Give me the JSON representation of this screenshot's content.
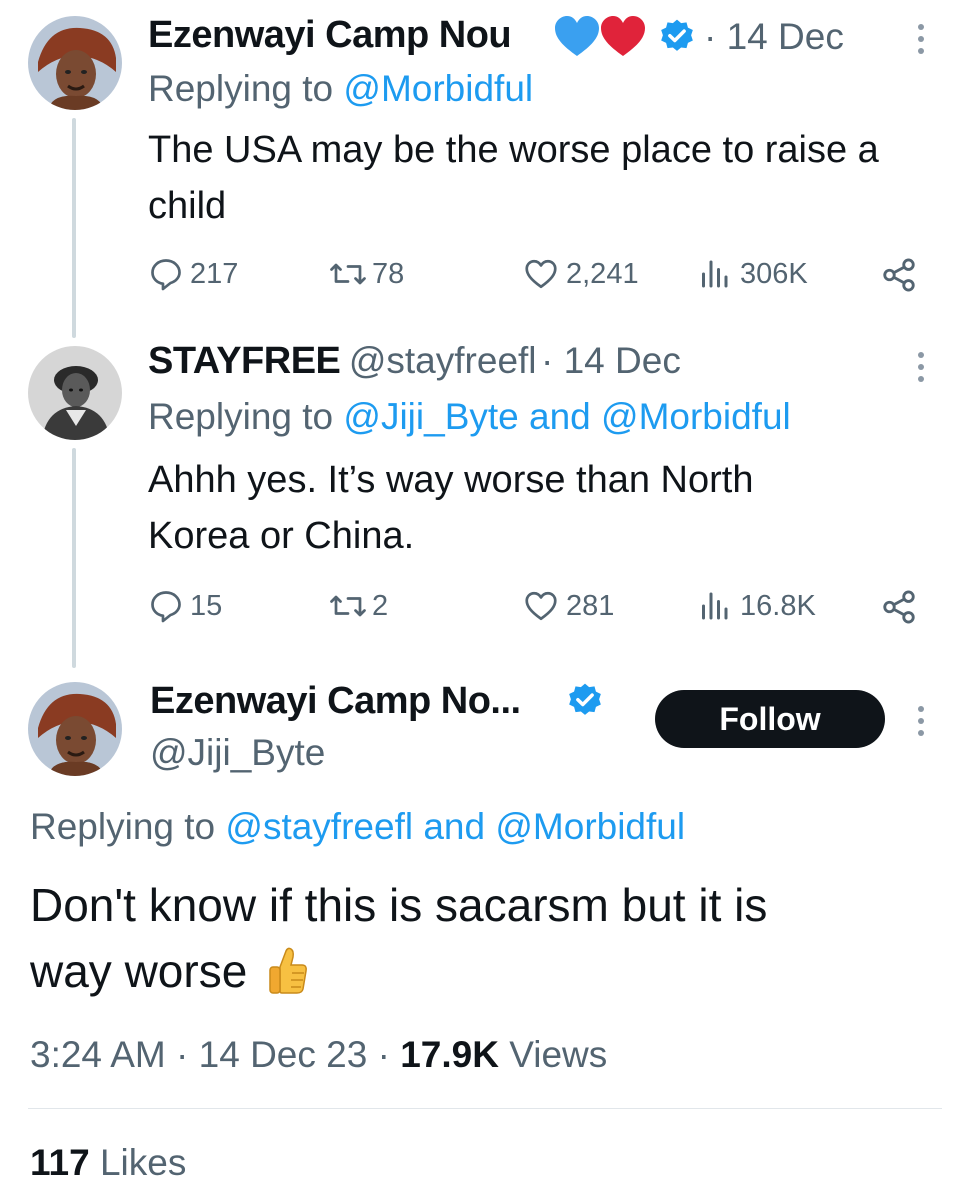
{
  "tweets": [
    {
      "display_name": "Ezenwayi Camp Nou",
      "verified": true,
      "timestamp": "· 14 Dec",
      "replying_prefix": "Replying to",
      "replying_to": "@Morbidful",
      "text": "The USA may be the worse place to raise a child",
      "stats": {
        "replies": "217",
        "retweets": "78",
        "likes": "2,241",
        "views": "306K"
      }
    },
    {
      "display_name": "STAYFREE",
      "handle": "@stayfreefl",
      "timestamp": "· 14 Dec",
      "replying_prefix": "Replying to",
      "replying_to": "@Jiji_Byte and @Morbidful",
      "text_line1": "Ahhh yes.  It’s way worse than North",
      "text_line2": "Korea or China.",
      "stats": {
        "replies": "15",
        "retweets": "2",
        "likes": "281",
        "views": "16.8K"
      }
    }
  ],
  "main_tweet": {
    "display_name": "Ezenwayi Camp No...",
    "verified": true,
    "handle": "@Jiji_Byte",
    "follow_label": "Follow",
    "replying_prefix": "Replying to",
    "replying_to": "@stayfreefl and @Morbidful",
    "text_line1": "Don't know if this is sacarsm but it is",
    "text_line2": "way worse",
    "emoji": "👍",
    "time": "3:24 AM",
    "date": "· 14 Dec 23 ·",
    "views_count": "17.9K",
    "views_label": "Views",
    "likes_count": "117",
    "likes_label": "Likes"
  },
  "colors": {
    "link": "#1d9bf0",
    "muted": "#536471",
    "text": "#0f1419",
    "verified": "#1d9bf0",
    "heart_blue": "#1d9bf0",
    "heart_red": "#e0245e"
  },
  "icons": [
    "reply-icon",
    "retweet-icon",
    "like-icon",
    "views-icon",
    "share-icon",
    "more-icon",
    "verified-badge-icon"
  ]
}
